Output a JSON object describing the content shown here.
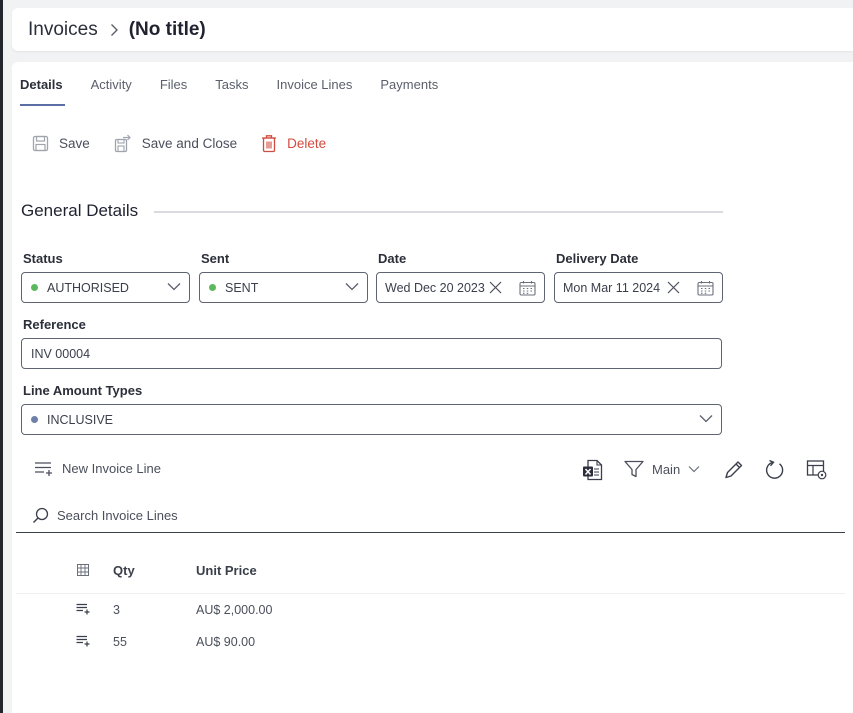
{
  "header": {
    "breadcrumb_root": "Invoices",
    "title": "(No title)"
  },
  "tabs": [
    {
      "label": "Details",
      "active": true
    },
    {
      "label": "Activity"
    },
    {
      "label": "Files"
    },
    {
      "label": "Tasks"
    },
    {
      "label": "Invoice Lines"
    },
    {
      "label": "Payments"
    }
  ],
  "toolbar": {
    "save_label": "Save",
    "save_close_label": "Save and Close",
    "delete_label": "Delete"
  },
  "section": {
    "title": "General Details"
  },
  "fields": {
    "status": {
      "label": "Status",
      "value": "AUTHORISED",
      "dot_color": "#5cb85c"
    },
    "sent": {
      "label": "Sent",
      "value": "SENT",
      "dot_color": "#5cb85c"
    },
    "date": {
      "label": "Date",
      "value": "Wed Dec 20 2023"
    },
    "delivery_date": {
      "label": "Delivery Date",
      "value": "Mon Mar 11 2024"
    },
    "reference": {
      "label": "Reference",
      "value": "INV 00004"
    },
    "line_amount_types": {
      "label": "Line Amount Types",
      "value": "INCLUSIVE",
      "dot_color": "#6f80a8"
    }
  },
  "grid": {
    "new_line_label": "New Invoice Line",
    "view_label": "Main",
    "search_placeholder": "Search Invoice Lines",
    "columns": {
      "qty": "Qty",
      "unit_price": "Unit Price"
    },
    "rows": [
      {
        "qty": "3",
        "unit_price": "AU$ 2,000.00"
      },
      {
        "qty": "55",
        "unit_price": "AU$ 90.00"
      }
    ]
  },
  "colors": {
    "accent": "#5c6ea6",
    "delete": "#d14b3f",
    "excel_green": "#1d6f42"
  },
  "icons": [
    "chevron-right-icon",
    "save-icon",
    "save-close-icon",
    "trash-icon",
    "chevron-down-icon",
    "clear-icon",
    "calendar-icon",
    "add-list-icon",
    "excel-icon",
    "filter-icon",
    "pencil-icon",
    "refresh-icon",
    "table-settings-icon",
    "search-icon",
    "grid-icon",
    "row-menu-icon"
  ]
}
